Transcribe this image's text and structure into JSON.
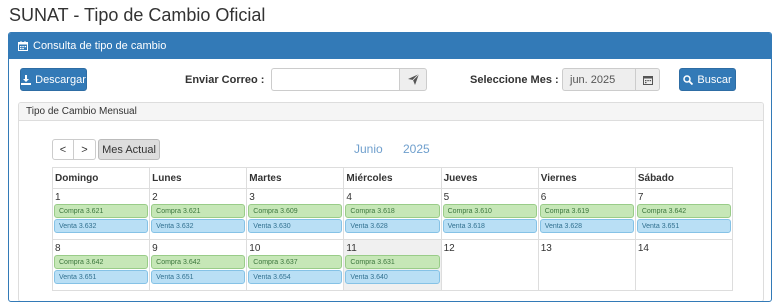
{
  "page": {
    "title": "SUNAT - Tipo de Cambio Oficial"
  },
  "panel": {
    "heading": "Consulta de tipo de cambio"
  },
  "toolbar": {
    "download_label": "Descargar",
    "email_label": "Enviar Correo :",
    "email_value": "",
    "month_label": "Seleccione Mes :",
    "month_value": "jun. 2025",
    "search_label": "Buscar"
  },
  "calendar": {
    "panel_title": "Tipo de Cambio Mensual",
    "prev_label": "<",
    "next_label": ">",
    "today_label": "Mes Actual",
    "month_name": "Junio",
    "year": "2025",
    "weekdays": [
      "Domingo",
      "Lunes",
      "Martes",
      "Miércoles",
      "Jueves",
      "Viernes",
      "Sábado"
    ],
    "weeks": [
      [
        {
          "day": "1",
          "buy": "Compra 3.621",
          "sell": "Venta 3.632"
        },
        {
          "day": "2",
          "buy": "Compra 3.621",
          "sell": "Venta 3.632"
        },
        {
          "day": "3",
          "buy": "Compra 3.609",
          "sell": "Venta 3.630"
        },
        {
          "day": "4",
          "buy": "Compra 3.618",
          "sell": "Venta 3.628"
        },
        {
          "day": "5",
          "buy": "Compra 3.610",
          "sell": "Venta 3.618"
        },
        {
          "day": "6",
          "buy": "Compra 3.619",
          "sell": "Venta 3.628"
        },
        {
          "day": "7",
          "buy": "Compra 3.642",
          "sell": "Venta 3.651"
        }
      ],
      [
        {
          "day": "8",
          "buy": "Compra 3.642",
          "sell": "Venta 3.651"
        },
        {
          "day": "9",
          "buy": "Compra 3.642",
          "sell": "Venta 3.651"
        },
        {
          "day": "10",
          "buy": "Compra 3.637",
          "sell": "Venta 3.654"
        },
        {
          "day": "11",
          "buy": "Compra 3.631",
          "sell": "Venta 3.640",
          "today": true
        },
        {
          "day": "12"
        },
        {
          "day": "13"
        },
        {
          "day": "14"
        }
      ]
    ]
  },
  "colors": {
    "primary": "#337ab7",
    "buy_bg": "#c6e7b7",
    "sell_bg": "#b9dff5",
    "title_blue": "#6f9fcd"
  },
  "icons": {
    "panel_heading": "calendar-icon",
    "download": "download-icon",
    "send": "paper-plane-icon",
    "month_picker": "calendar-icon",
    "search": "search-icon"
  }
}
